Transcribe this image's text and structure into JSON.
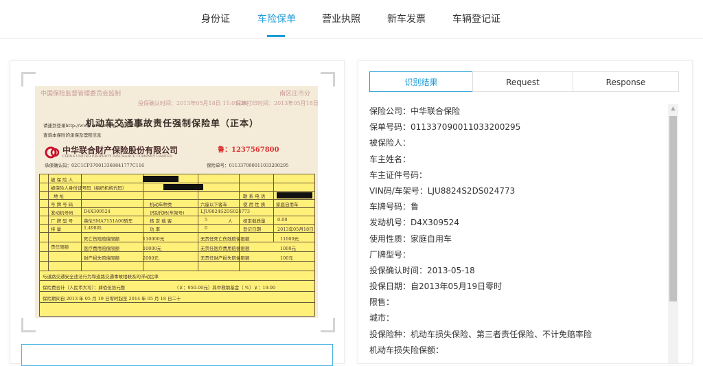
{
  "tabs": [
    {
      "label": "身份证"
    },
    {
      "label": "车险保单"
    },
    {
      "label": "营业执照"
    },
    {
      "label": "新车发票"
    },
    {
      "label": "车辆登记证"
    }
  ],
  "active_tab_index": 1,
  "accent_color": "#1e9bd7",
  "segments": {
    "result": "识别结果",
    "request": "Request",
    "response": "Response"
  },
  "results": [
    "保险公司：中华联合保险",
    "保单号码：011337090011033200295",
    "被保险人：",
    "车主姓名：",
    "车主证件号码：",
    "VIN码/车架号：LJU8824S2DS024773",
    "车牌号码：鲁",
    "发动机号：D4X309524",
    "使用性质：家庭自用车",
    "厂牌型号：",
    "投保确认时间：2013-05-18",
    "投保日期：自2013年05月19日零时",
    "限售：",
    "城市：",
    "投保险种：机动车损失保险、第三者责任保险、不计免赔率险",
    "机动车损失险保额："
  ],
  "document": {
    "header_left": "中国保险监督管理委员会监制",
    "header_right": "南区庄市分",
    "confirm_line": "投保确认时间：2013年05月18日 11:03:26",
    "print_line": "保单打印时间：2013年05月18日 11:",
    "query_line": "请速到登录http://www.circ.cn网址，拨打95585",
    "query_line2": "查询本保险的承保及理赔信息",
    "title": "机动车交通事故责任强制保险单（正本）",
    "company": "中华联合财产保险股份有限公司",
    "company_en": "CHINA UNITED PROPERTY INSURANCE COMPANY LIMITED",
    "code": "承保确认码：02C1CP370013368841777C116",
    "stamp": "鲁：1237567800",
    "policy_no": "保险单号：011337090011033200295",
    "cells": {
      "insured": "被 保 险 人",
      "id_no": "被保险人身份证号码（组织机构代码）",
      "address": "地  址",
      "contact": "联 系 电 话",
      "plate": "号 牌 号 码",
      "vehicle_type": "机动车种类",
      "vehicle_type_val": "六座以下客车",
      "use": "使 用 性 质",
      "use_val": "家庭自用车",
      "engine": "发动机号码",
      "engine_val": "D4X309524",
      "vin": "识别代码(车架号)",
      "vin_val": "LJU8824S2DS024773",
      "brand": "厂 牌 型 号",
      "brand_val": "英伦SMA7151A06轿车",
      "seats": "核 定 载 客",
      "seats_val": "5",
      "seats_unit": "人",
      "load": "核定载质量",
      "load_val": "0.00",
      "displacement": "排   量",
      "displacement_val": "1.4980L",
      "power": "功   率",
      "power_val": "0",
      "reg_date": "登记日期",
      "reg_date_val": "2013年05月18日",
      "death": "死亡伤残赔偿限额",
      "death_val": "110000元",
      "medical": "医疗费用赔偿限额",
      "medical_val": "10000元",
      "property": "财产损失赔偿限额",
      "property_val": "2000元",
      "nofault_death": "无责任死亡伤残赔偿限额",
      "nofault_death_val": "11000元",
      "nofault_medical": "无责任医疗费用赔偿限额",
      "nofault_medical_val": "1000元",
      "nofault_property": "无责任财产损失赔偿限额",
      "nofault_property_val": "100元",
      "limits": "责任限额",
      "float_rate": "与道路交通安全违法行为和道路交通事故相联系的浮动比率",
      "premium": "保险费合计（人民币大写）：肆佰伍拾元整",
      "premium_val": "（￥：950.00元）其中救助基金（    %）￥：19.00",
      "period": "保险期间自 2013 年 05 月 19 日零时起至 2014 年 05 月 18 日二十"
    }
  }
}
